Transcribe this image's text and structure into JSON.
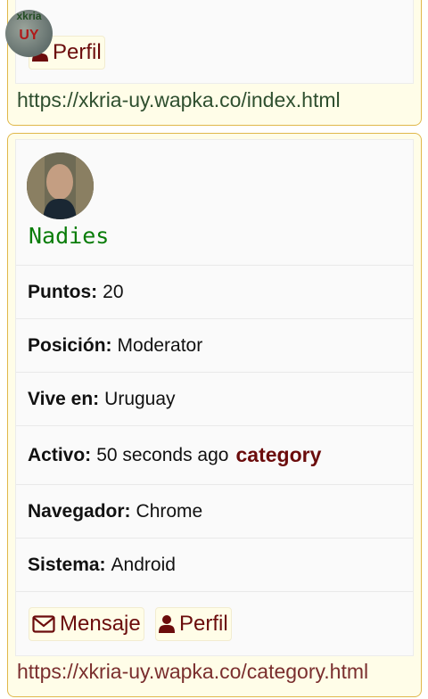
{
  "top_card": {
    "logo_text_line1": "xkria",
    "logo_text_line2": "UY",
    "profile_button": "Perfil",
    "url": "https://xkria-uy.wapka.co/index.html"
  },
  "user_card": {
    "username": "Nadies",
    "fields": [
      {
        "label": "Puntos:",
        "value": "20"
      },
      {
        "label": "Posición:",
        "value": "Moderator"
      },
      {
        "label": "Vive en:",
        "value": "Uruguay"
      },
      {
        "label": "Activo:",
        "value": "50 seconds ago",
        "extra": "category"
      },
      {
        "label": "Navegador:",
        "value": "Chrome"
      },
      {
        "label": "Sistema:",
        "value": "Android"
      }
    ],
    "message_button": "Mensaje",
    "profile_button": "Perfil",
    "url": "https://xkria-uy.wapka.co/category.html"
  },
  "colors": {
    "card_border": "#e0b84a",
    "card_bg": "#fffde8",
    "username": "#0a7d0a",
    "button_text": "#6b0c0c",
    "url_top": "#2f4f2f",
    "url_bottom": "#7a2e2e"
  }
}
